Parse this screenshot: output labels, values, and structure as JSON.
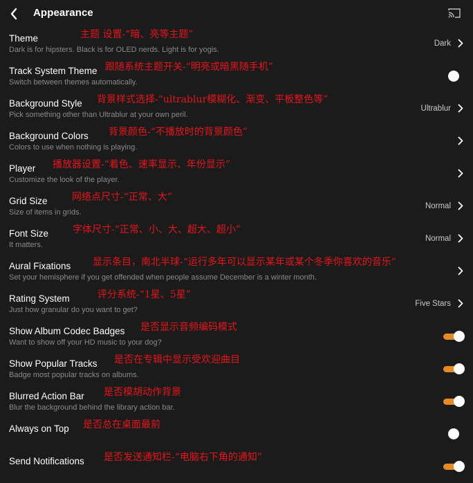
{
  "header": {
    "title": "Appearance"
  },
  "rows": [
    {
      "label": "Theme",
      "desc": "Dark is for hipsters. Black is for OLED nerds. Light is for yogis.",
      "value": "Dark",
      "anno": "主题 设置-“暗、亮等主题”"
    },
    {
      "label": "Track System Theme",
      "desc": "Switch between themes automatically.",
      "anno": "跟随系统主题开关-“明亮或暗黑随手机”",
      "toggle": "off"
    },
    {
      "label": "Background Style",
      "desc": "Pick something other than Ultrablur at your own peril.",
      "value": "Ultrablur",
      "anno": "背景样式选择-“ultrablur模糊化、渐变、平板整色等”"
    },
    {
      "label": "Background Colors",
      "desc": "Colors to use when nothing is playing.",
      "anno": "背景颜色-“不播放时的背景颜色”"
    },
    {
      "label": "Player",
      "desc": "Customize the look of the player.",
      "anno": "播放器设置-“着色、速率显示、年份显示”"
    },
    {
      "label": "Grid Size",
      "desc": "Size of items in grids.",
      "value": "Normal",
      "anno": "网络点尺寸-“正常、大”"
    },
    {
      "label": "Font Size",
      "desc": "It matters.",
      "value": "Normal",
      "anno": "字体尺寸-“正常、小、大、超大、超小”"
    },
    {
      "label": "Aural Fixations",
      "desc": "Set your hemisphere if you get offended when people assume December is a winter month.",
      "anno": "显示条目，南北半球-“运行多年可以显示某年或某个冬季你喜欢的音乐”"
    },
    {
      "label": "Rating System",
      "desc": "Just how granular do you want to get?",
      "value": "Five Stars",
      "anno": "评分系统-“1星、5星”"
    },
    {
      "label": "Show Album Codec Badges",
      "desc": "Want to show off your HD music to your dog?",
      "anno": "是否显示音频编码模式",
      "toggle": "on"
    },
    {
      "label": "Show Popular Tracks",
      "desc": "Badge most popular tracks on albums.",
      "anno": "是否在专辑中显示受欢迎曲目",
      "toggle": "on"
    },
    {
      "label": "Blurred Action Bar",
      "desc": "Blur the background behind the library action bar.",
      "anno": "是否模胡动作背景",
      "toggle": "on"
    },
    {
      "label": "Always on Top",
      "desc": "",
      "anno": "是否总在桌面最前",
      "toggle": "off"
    },
    {
      "label": "Send Notifications",
      "desc": "",
      "anno": "是否发送通知栏-“电脑右下角的通知”",
      "toggle": "on"
    }
  ],
  "colors": {
    "accent": "#e58a28",
    "background": "#1b1b1b",
    "annotation": "#e4161c"
  },
  "icons": {
    "back": "chevron-left-icon",
    "cast": "cast-icon",
    "row": "chevron-right-icon"
  }
}
